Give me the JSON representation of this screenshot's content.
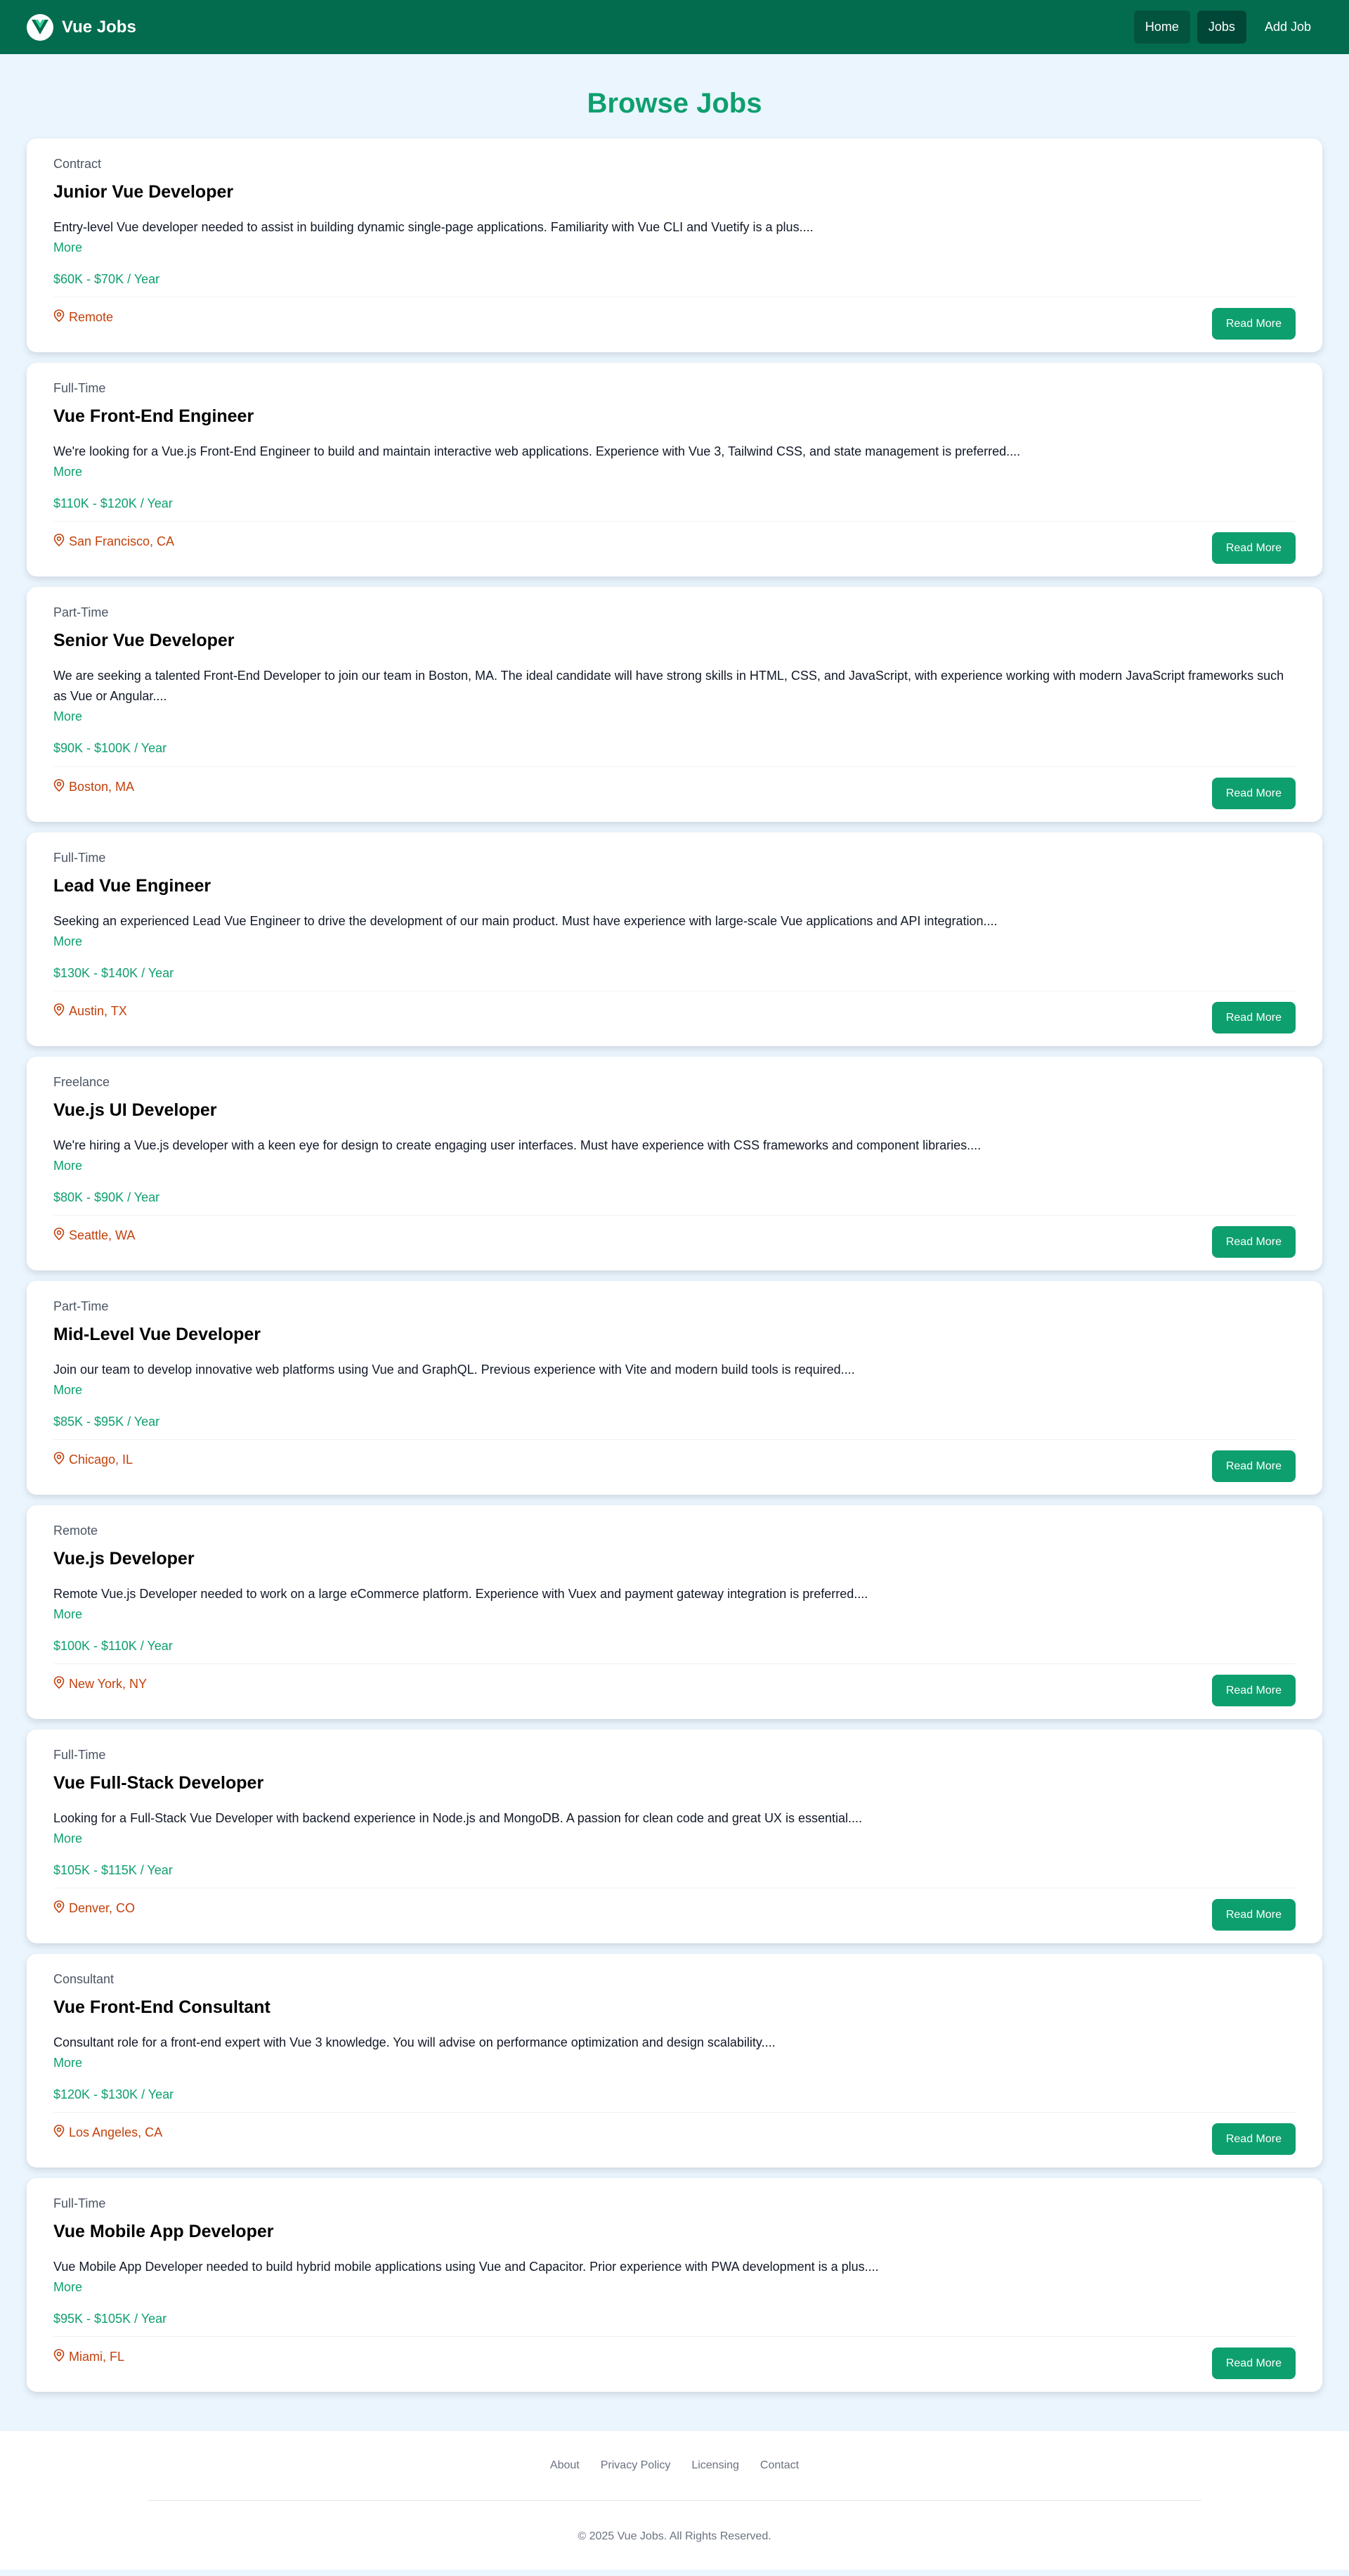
{
  "brand": {
    "name": "Vue Jobs",
    "logo_icon": "vue-logo-icon"
  },
  "nav": {
    "home": "Home",
    "jobs": "Jobs",
    "add_job": "Add Job"
  },
  "page": {
    "title": "Browse Jobs"
  },
  "jobs": [
    {
      "type": "Contract",
      "title": "Junior Vue Developer",
      "description": "Entry-level Vue developer needed to assist in building dynamic single-page applications. Familiarity with Vue CLI and Vuetify is a plus....",
      "more": "More",
      "salary": "$60K - $70K / Year",
      "location": "Remote",
      "button": "Read More"
    },
    {
      "type": "Full-Time",
      "title": "Vue Front-End Engineer",
      "description": "We're looking for a Vue.js Front-End Engineer to build and maintain interactive web applications. Experience with Vue 3, Tailwind CSS, and state management is preferred....",
      "more": "More",
      "salary": "$110K - $120K / Year",
      "location": "San Francisco, CA",
      "button": "Read More"
    },
    {
      "type": "Part-Time",
      "title": "Senior Vue Developer",
      "description": "We are seeking a talented Front-End Developer to join our team in Boston, MA. The ideal candidate will have strong skills in HTML, CSS, and JavaScript, with experience working with modern JavaScript frameworks such as Vue or Angular....",
      "more": "More",
      "salary": "$90K - $100K / Year",
      "location": "Boston, MA",
      "button": "Read More"
    },
    {
      "type": "Full-Time",
      "title": "Lead Vue Engineer",
      "description": "Seeking an experienced Lead Vue Engineer to drive the development of our main product. Must have experience with large-scale Vue applications and API integration....",
      "more": "More",
      "salary": "$130K - $140K / Year",
      "location": "Austin, TX",
      "button": "Read More"
    },
    {
      "type": "Freelance",
      "title": "Vue.js UI Developer",
      "description": "We're hiring a Vue.js developer with a keen eye for design to create engaging user interfaces. Must have experience with CSS frameworks and component libraries....",
      "more": "More",
      "salary": "$80K - $90K / Year",
      "location": "Seattle, WA",
      "button": "Read More"
    },
    {
      "type": "Part-Time",
      "title": "Mid-Level Vue Developer",
      "description": "Join our team to develop innovative web platforms using Vue and GraphQL. Previous experience with Vite and modern build tools is required....",
      "more": "More",
      "salary": "$85K - $95K / Year",
      "location": "Chicago, IL",
      "button": "Read More"
    },
    {
      "type": "Remote",
      "title": "Vue.js Developer",
      "description": "Remote Vue.js Developer needed to work on a large eCommerce platform. Experience with Vuex and payment gateway integration is preferred....",
      "more": "More",
      "salary": "$100K - $110K / Year",
      "location": "New York, NY",
      "button": "Read More"
    },
    {
      "type": "Full-Time",
      "title": "Vue Full-Stack Developer",
      "description": "Looking for a Full-Stack Vue Developer with backend experience in Node.js and MongoDB. A passion for clean code and great UX is essential....",
      "more": "More",
      "salary": "$105K - $115K / Year",
      "location": "Denver, CO",
      "button": "Read More"
    },
    {
      "type": "Consultant",
      "title": "Vue Front-End Consultant",
      "description": "Consultant role for a front-end expert with Vue 3 knowledge. You will advise on performance optimization and design scalability....",
      "more": "More",
      "salary": "$120K - $130K / Year",
      "location": "Los Angeles, CA",
      "button": "Read More"
    },
    {
      "type": "Full-Time",
      "title": "Vue Mobile App Developer",
      "description": "Vue Mobile App Developer needed to build hybrid mobile applications using Vue and Capacitor. Prior experience with PWA development is a plus....",
      "more": "More",
      "salary": "$95K - $105K / Year",
      "location": "Miami, FL",
      "button": "Read More"
    }
  ],
  "footer": {
    "links": [
      "About",
      "Privacy Policy",
      "Licensing",
      "Contact"
    ],
    "copyright": "© 2025 Vue Jobs. All Rights Reserved."
  },
  "colors": {
    "navbar": "#046c4e",
    "accent_green": "#0e9f6e",
    "location_orange": "#c2410c",
    "page_background": "#ebf5fe"
  }
}
